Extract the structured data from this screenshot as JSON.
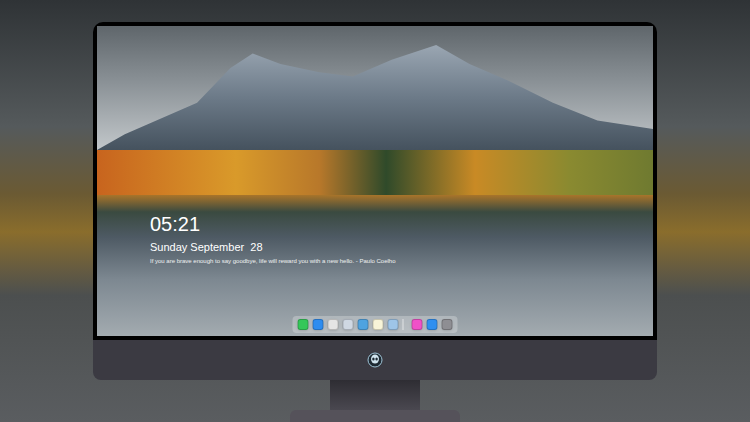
{
  "lock_screen": {
    "time": "05:21",
    "date": "Sunday September  28",
    "quote": "If you are brave enough to say goodbye, life will reward you with a new hello.  - Paulo Coelho"
  },
  "dock": {
    "groups": [
      {
        "items": [
          {
            "color": "#34c759"
          },
          {
            "color": "#2d8cf0"
          },
          {
            "color": "#e5e5e5"
          },
          {
            "color": "#cfd8e3"
          },
          {
            "color": "#4fa3e0"
          },
          {
            "color": "#f8f4d8"
          },
          {
            "color": "#9ec5e8"
          }
        ]
      },
      {
        "items": [
          {
            "color": "#f050c8"
          },
          {
            "color": "#2f8ff0"
          },
          {
            "color": "#8e8e93"
          }
        ]
      }
    ]
  }
}
